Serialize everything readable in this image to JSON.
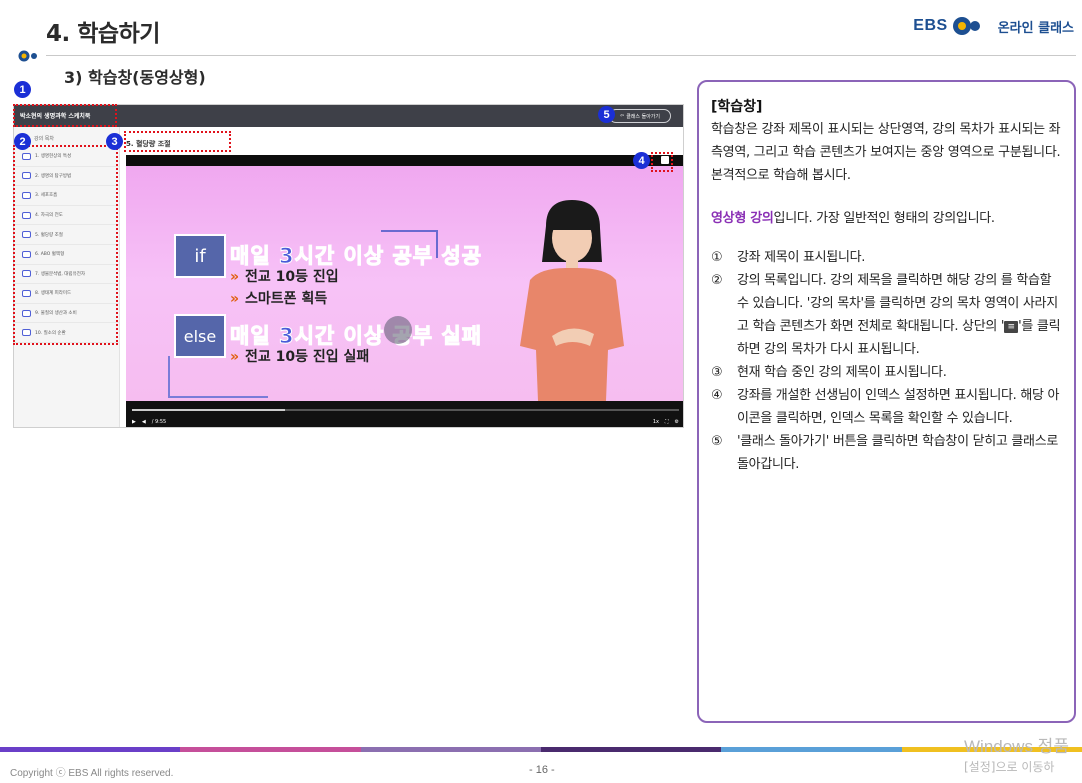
{
  "header": {
    "title": "4. 학습하기",
    "subtitle": "3) 학습창(동영상형)",
    "brand_ebs": "EBS",
    "brand_online": "온라인 클래스"
  },
  "markers": [
    "1",
    "2",
    "3",
    "4",
    "5"
  ],
  "screenshot": {
    "course_title": "박소현의 생명과학 스케치북",
    "back_button": "클래스 돌아가기",
    "sidebar_header": "강의 목차",
    "lessons": [
      "1. 생명현상의 특성",
      "2. 생명의 탐구방법",
      "3. 세포호흡",
      "4. 자극의 전도",
      "5. 혈당량 조절",
      "6. ABO 혈액형",
      "7. 생물분석법, 대립유전자",
      "8. 생태계 피라미드",
      "9. 물질의 생산과 소비",
      "10. 질소의 순환"
    ],
    "current_lesson": "5. 혈당량 조절",
    "video": {
      "box_if": "if",
      "box_else": "else",
      "line1": "매일 3시간 이상 공부 성공",
      "sub1": "전교 10등 진입",
      "sub2": "스마트폰 획득",
      "line2": "매일 3시간 이상 공부 실패",
      "sub3": "전교 10등 진입 실패",
      "arrow": "»",
      "time": "/ 9:55",
      "speed": "1x",
      "progress": 0.28
    }
  },
  "panel": {
    "title": "[학습창]",
    "intro": "학습창은 강좌 제목이 표시되는 상단영역, 강의 목차가 표시되는 좌측영역, 그리고 학습 콘텐츠가 보여지는 중앙 영역으로 구분됩니다. 본격적으로 학습해 봅시다.",
    "video_accent": "영상형 강의",
    "video_rest": "입니다. 가장 일반적인 형태의 강의입니다.",
    "items": [
      {
        "num": "①",
        "text": "강좌 제목이 표시됩니다."
      },
      {
        "num": "②",
        "text_a": "강의 목록입니다. 강의 제목을 클릭하면 해당 강의 를 학습할 수 있습니다. '강의 목차'를 클릭하면 강의 목차 영역이 사라지고 학습 콘텐츠가 화면 전체로 확대됩니다. 상단의 '",
        "text_b": "'를 클릭하면 강의 목차가 다시 표시됩니다."
      },
      {
        "num": "③",
        "text": "현재 학습 중인 강의 제목이 표시됩니다."
      },
      {
        "num": "④",
        "text": "강좌를 개설한 선생님이 인덱스 설정하면 표시됩니다. 해당 아이콘을 클릭하면, 인덱스 목록을 확인할 수 있습니다."
      },
      {
        "num": "⑤",
        "text": "'클래스 돌아가기' 버튼을 클릭하면 학습창이 닫히고 클래스로 돌아갑니다."
      }
    ]
  },
  "footer": {
    "copyright": "Copyright ⓒ EBS All rights reserved.",
    "page": "- 16 -",
    "watermark1": "Windows 정품",
    "watermark2": "[설정]으로 이동하"
  },
  "colors": {
    "marker": "#1b2fd6",
    "panel_border": "#8b64b8",
    "accent": "#8a2fb5",
    "highlight": "#e0121b",
    "footer_bar": [
      "#6a3fc8",
      "#c54f9a",
      "#8b6fb0",
      "#4a2a6e",
      "#5aa0d8",
      "#f0c020"
    ]
  }
}
